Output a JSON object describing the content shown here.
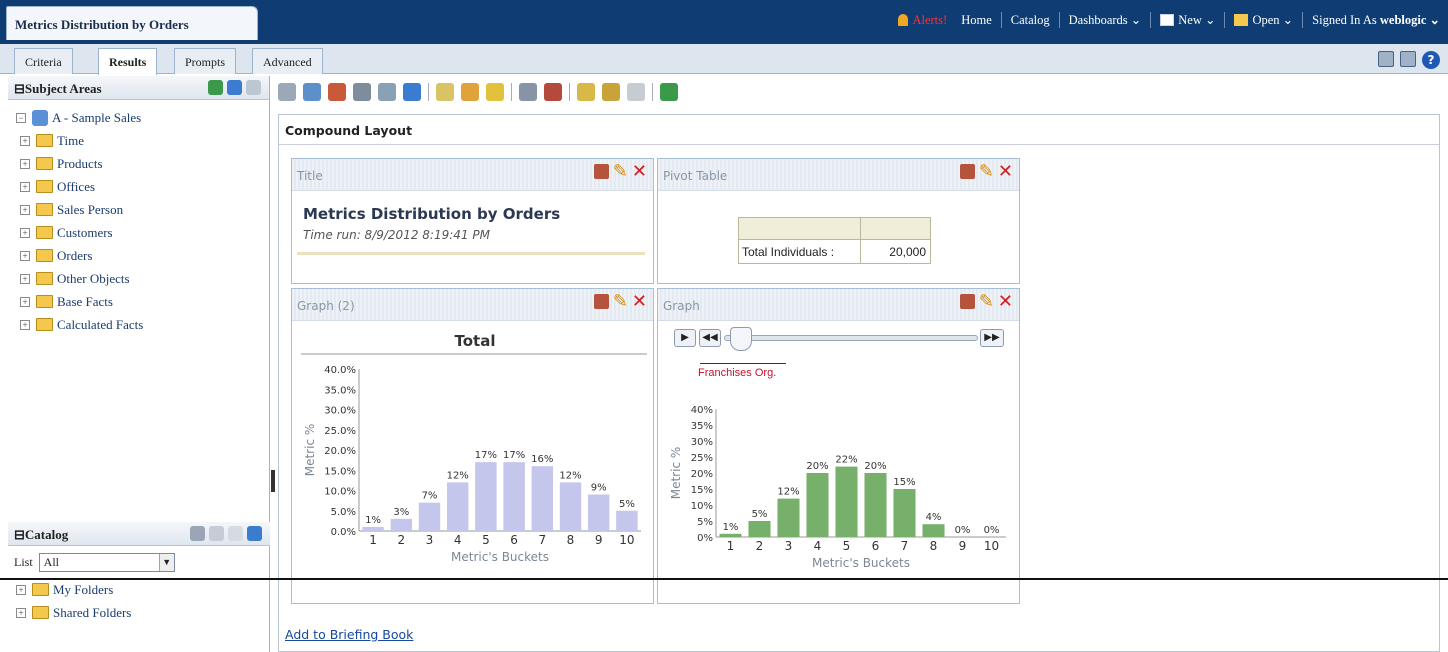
{
  "window_title": "Metrics Distribution by Orders",
  "topnav": {
    "alerts": "Alerts!",
    "home": "Home",
    "catalog": "Catalog",
    "dashboards": "Dashboards ⌄",
    "new": "New ⌄",
    "open": "Open ⌄",
    "signed_in_prefix": "Signed In As",
    "user": "weblogic ⌄"
  },
  "tabs": [
    "Criteria",
    "Results",
    "Prompts",
    "Advanced"
  ],
  "subject_areas": {
    "title": "Subject Areas",
    "root": "A - Sample Sales",
    "items": [
      "Time",
      "Products",
      "Offices",
      "Sales Person",
      "Customers",
      "Orders",
      "Other Objects",
      "Base Facts",
      "Calculated Facts"
    ]
  },
  "catalog": {
    "title": "Catalog",
    "list_label": "List",
    "list_value": "All",
    "items": [
      "My Folders",
      "Shared Folders"
    ]
  },
  "compound": {
    "title": "Compound Layout",
    "add_briefing": "Add to Briefing Book"
  },
  "views": {
    "title_view": {
      "label": "Title",
      "heading": "Metrics Distribution by Orders",
      "time_run": "Time run: 8/9/2012 8:19:41 PM"
    },
    "pivot_view": {
      "label": "Pivot Table",
      "row_label": "Total Individuals :",
      "row_value": "20,000"
    },
    "graph2_view": {
      "label": "Graph (2)"
    },
    "graph_view": {
      "label": "Graph",
      "slider_label": "Franchises Org."
    }
  },
  "chart_data": [
    {
      "type": "bar",
      "title": "Total",
      "xlabel": "Metric's Buckets",
      "ylabel": "Metric %",
      "categories": [
        "1",
        "2",
        "3",
        "4",
        "5",
        "6",
        "7",
        "8",
        "9",
        "10"
      ],
      "values": [
        1,
        3,
        7,
        12,
        17,
        17,
        16,
        12,
        9,
        5
      ],
      "data_labels": [
        "1%",
        "3%",
        "7%",
        "12%",
        "17%",
        "17%",
        "16%",
        "12%",
        "9%",
        "5%"
      ],
      "yticks": [
        "0.0%",
        "5.0%",
        "10.0%",
        "15.0%",
        "20.0%",
        "25.0%",
        "30.0%",
        "35.0%",
        "40.0%"
      ],
      "ylim": [
        0,
        40
      ],
      "color": "#c4c6ec"
    },
    {
      "type": "bar",
      "title": "",
      "xlabel": "Metric's Buckets",
      "ylabel": "Metric %",
      "categories": [
        "1",
        "2",
        "3",
        "4",
        "5",
        "6",
        "7",
        "8",
        "9",
        "10"
      ],
      "values": [
        1,
        5,
        12,
        20,
        22,
        20,
        15,
        4,
        0,
        0
      ],
      "data_labels": [
        "1%",
        "5%",
        "12%",
        "20%",
        "22%",
        "20%",
        "15%",
        "4%",
        "0%",
        "0%"
      ],
      "yticks": [
        "0%",
        "5%",
        "10%",
        "15%",
        "20%",
        "25%",
        "30%",
        "35%",
        "40%"
      ],
      "ylim": [
        0,
        40
      ],
      "color": "#76b06b"
    }
  ]
}
